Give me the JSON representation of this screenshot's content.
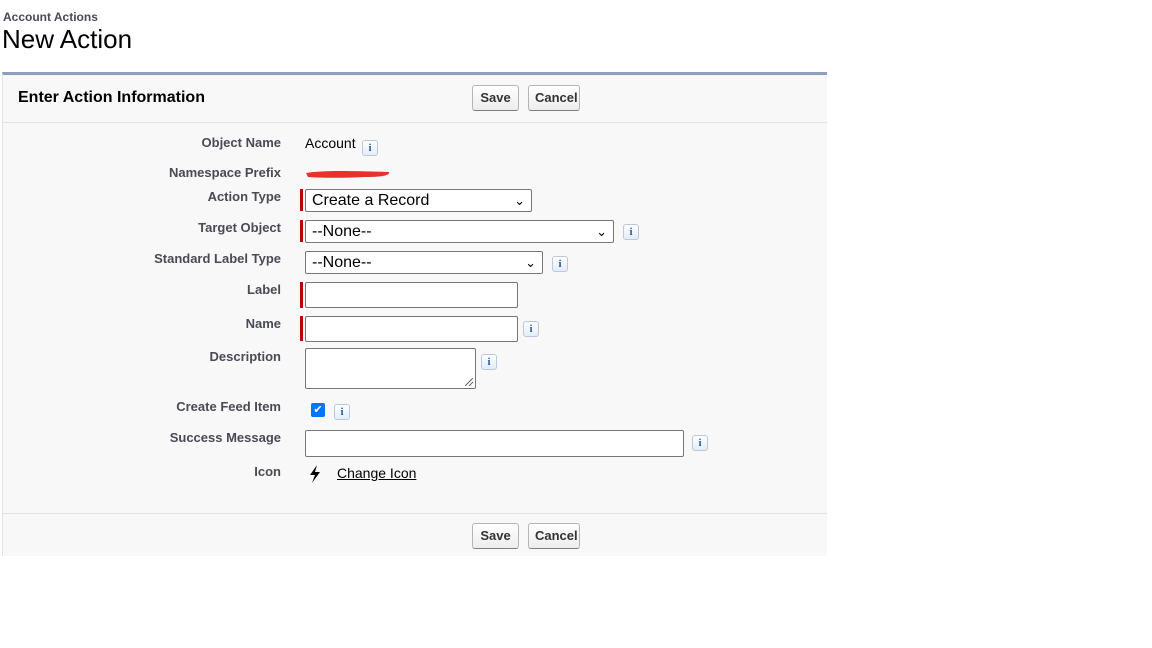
{
  "header": {
    "breadcrumb": "Account Actions",
    "title": "New Action"
  },
  "panel": {
    "title": "Enter Action Information",
    "save_label": "Save",
    "cancel_label": "Cancel"
  },
  "form": {
    "object_name": {
      "label": "Object Name",
      "value": "Account"
    },
    "namespace_prefix": {
      "label": "Namespace Prefix"
    },
    "action_type": {
      "label": "Action Type",
      "value": "Create a Record"
    },
    "target_object": {
      "label": "Target Object",
      "value": "--None--"
    },
    "standard_label_type": {
      "label": "Standard Label Type",
      "value": "--None--"
    },
    "label": {
      "label": "Label",
      "value": ""
    },
    "name": {
      "label": "Name",
      "value": ""
    },
    "description": {
      "label": "Description",
      "value": ""
    },
    "create_feed_item": {
      "label": "Create Feed Item",
      "checked": true
    },
    "success_message": {
      "label": "Success Message",
      "value": ""
    },
    "icon": {
      "label": "Icon",
      "link": "Change Icon",
      "icon_name": "lightning-bolt-icon"
    }
  },
  "info_glyph": "i",
  "colors": {
    "required_bar": "#c00000",
    "panel_border_top": "#8e9dbe",
    "checkbox": "#0075ff",
    "redaction": "#e8312b"
  }
}
